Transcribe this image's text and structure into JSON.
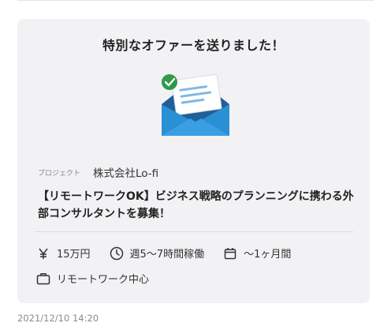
{
  "offer": {
    "title": "特別なオファーを送りました！"
  },
  "project": {
    "label": "プロジェクト",
    "company": "株式会社Lo-fi",
    "title": "【リモートワークOK】ビジネス戦略のプランニングに携わる外部コンサルタントを募集！"
  },
  "details": {
    "fee": "15万円",
    "workload": "週5〜7時間稼働",
    "period": "〜1ヶ月間",
    "location": "リモートワーク中心"
  },
  "icons": {
    "fee": "yen-icon",
    "workload": "clock-icon",
    "period": "calendar-icon",
    "location": "briefcase-icon",
    "illustration": "envelope-check-icon"
  },
  "colors": {
    "envelope_dark": "#1f5f9a",
    "envelope_light": "#2b8fd6",
    "check_green": "#2e9a4a",
    "card_bg": "#f2f2f4"
  },
  "timestamp": "2021/12/10 14:20"
}
